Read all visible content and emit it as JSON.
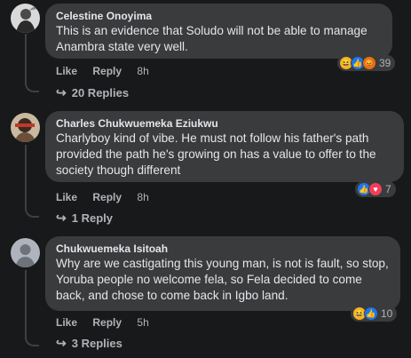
{
  "comments": [
    {
      "author": "Celestine Onoyima",
      "text": "This is an evidence that Soludo will not be able to manage Anambra state very well.",
      "like_label": "Like",
      "reply_label": "Reply",
      "time": "8h",
      "reactions": [
        "haha",
        "like",
        "angry"
      ],
      "reaction_count": "39",
      "replies_label": "20 Replies"
    },
    {
      "author": "Charles Chukwuemeka Eziukwu",
      "text": "Charlyboy kind of vibe. He must not follow his father's path provided the path he's growing on has a value to offer to the society though different",
      "like_label": "Like",
      "reply_label": "Reply",
      "time": "8h",
      "reactions": [
        "like",
        "love"
      ],
      "reaction_count": "7",
      "replies_label": "1 Reply"
    },
    {
      "author": "Chukwuemeka Isitoah",
      "text": "Why are we castigating this young man, is not is fault, so stop, Yoruba people no welcome fela, so Fela decided to come back, and chose to come back in Igbo land.",
      "like_label": "Like",
      "reply_label": "Reply",
      "time": "5h",
      "reactions": [
        "haha",
        "like"
      ],
      "reaction_count": "10",
      "replies_label": "3 Replies"
    }
  ],
  "colors": {
    "background": "#18191a",
    "bubble": "#3a3b3c",
    "like_blue": "#1877f2",
    "love_red": "#f33e58",
    "haha_yellow": "#f7b125",
    "angry_orange": "#e9710f"
  }
}
